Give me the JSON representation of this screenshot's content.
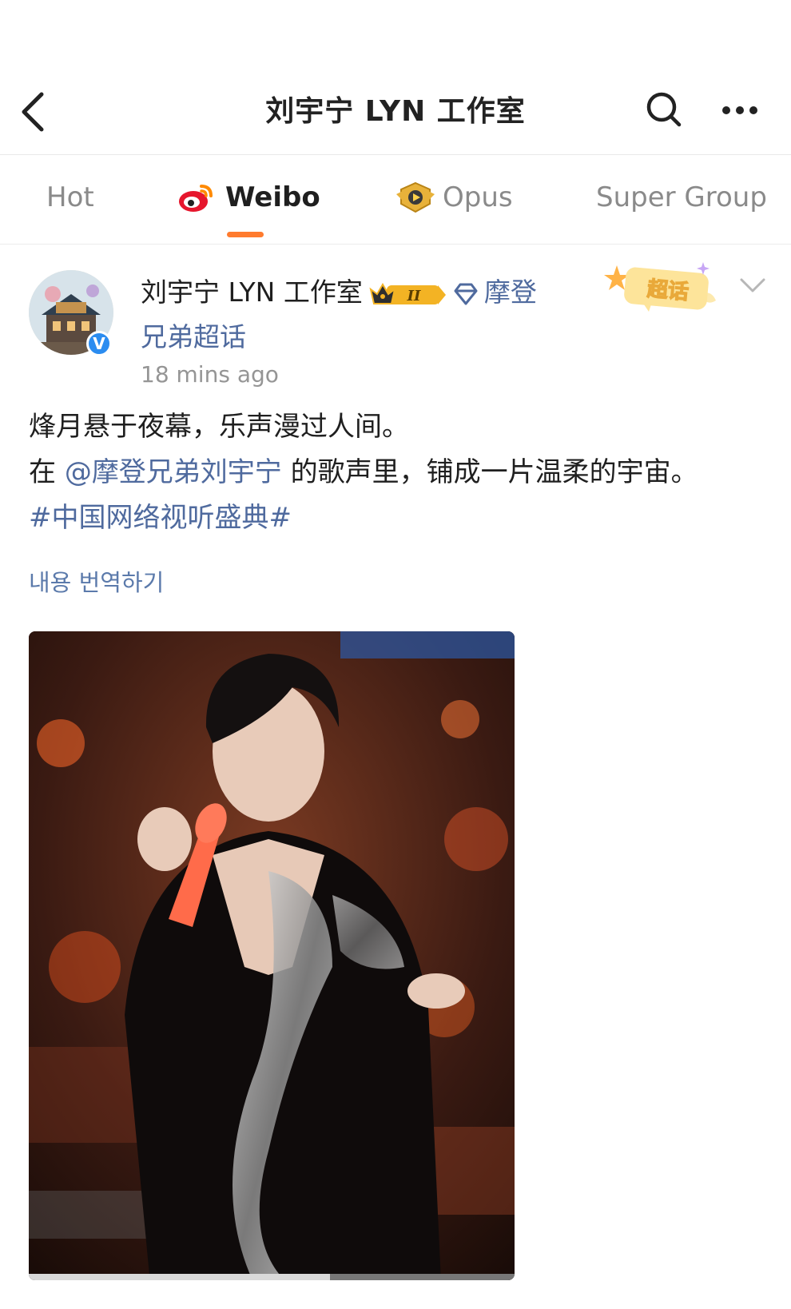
{
  "header": {
    "title": "刘宇宁 LYN 工作室",
    "icons": {
      "back": "chevron-left-icon",
      "search": "search-icon",
      "more": "more-horizontal-icon"
    }
  },
  "tabs": [
    {
      "label": "Hot",
      "active": false
    },
    {
      "label": "Weibo",
      "active": true,
      "icon": "weibo-logo-icon"
    },
    {
      "label": "Opus",
      "active": false,
      "icon": "opus-badge-icon"
    },
    {
      "label": "Super Group",
      "active": false
    }
  ],
  "post": {
    "author": "刘宇宁 LYN 工作室",
    "supertopic": "摩登兄弟超话",
    "verified_mark": "V",
    "rank_badge": "II",
    "timestamp": "18 mins ago",
    "chaohua_label": "超话",
    "text_line1": "烽月悬于夜幕，乐声漫过人间。",
    "text_line2_prefix": "在",
    "mention": "@摩登兄弟刘宇宁",
    "text_line2_suffix": "的歌声里，铺成一片温柔的宇宙。",
    "hashtag": "#中国网络视听盛典#",
    "translate_label": "내용 번역하기",
    "image_progress": 0.62
  },
  "colors": {
    "accent": "#ff7b2e",
    "link": "#4f6a9e",
    "translate": "#5b7aab",
    "muted": "#959595",
    "verified": "#2b8cf0"
  }
}
